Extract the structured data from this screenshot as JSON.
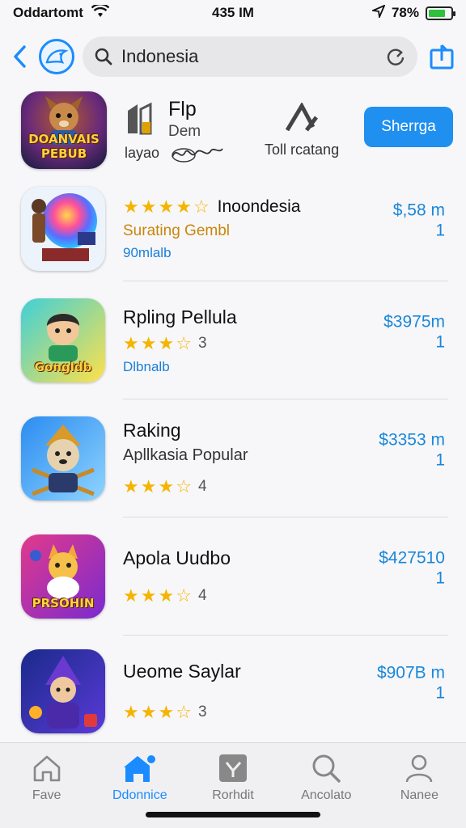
{
  "status": {
    "carrier": "Oddartomt",
    "time": "435 IM",
    "battery": "78%",
    "battery_level": 0.78
  },
  "search": {
    "value": "Indonesia"
  },
  "featured": {
    "icon_label": "DOANVAIS PEBUB",
    "title": "Flp",
    "subtitle": "Dem",
    "small_left": "layao",
    "small_mid": "Toll rcatang",
    "button": "Sherrga"
  },
  "apps": [
    {
      "icon_label": "",
      "title": "Inoondesia",
      "rating": 4.5,
      "line2": "Surating Gembl",
      "line3": "90mlalb",
      "price": "$,58 m",
      "price2": "1"
    },
    {
      "icon_label": "Gongldb",
      "title": "Rpling Pellula",
      "rating": 3.5,
      "rating_count": "3",
      "line3": "Dlbnalb",
      "price": "$3975m",
      "price2": "1"
    },
    {
      "icon_label": "",
      "title": "Raking",
      "subtitle": "Apllkasia Popular",
      "rating": 3.5,
      "rating_count": "4",
      "price": "$3353 m",
      "price2": "1"
    },
    {
      "icon_label": "PRSOHIN",
      "title": "Apola Uudbo",
      "rating": 3.5,
      "rating_count": "4",
      "price": "$427510",
      "price2": "1"
    },
    {
      "icon_label": "",
      "title": "Ueome Saylar",
      "rating": 3.5,
      "rating_count": "3",
      "price": "$907B m",
      "price2": "1"
    }
  ],
  "tabs": [
    {
      "label": "Fave",
      "icon": "home-icon"
    },
    {
      "label": "Ddonnice",
      "icon": "store-icon"
    },
    {
      "label": "Rorhdit",
      "icon": "apps-icon"
    },
    {
      "label": "Ancolato",
      "icon": "search-icon"
    },
    {
      "label": "Nanee",
      "icon": "person-icon"
    }
  ],
  "colors": {
    "accent": "#1a8cff",
    "price": "#1a87d9",
    "star": "#f5b400",
    "orange": "#c8860d"
  }
}
